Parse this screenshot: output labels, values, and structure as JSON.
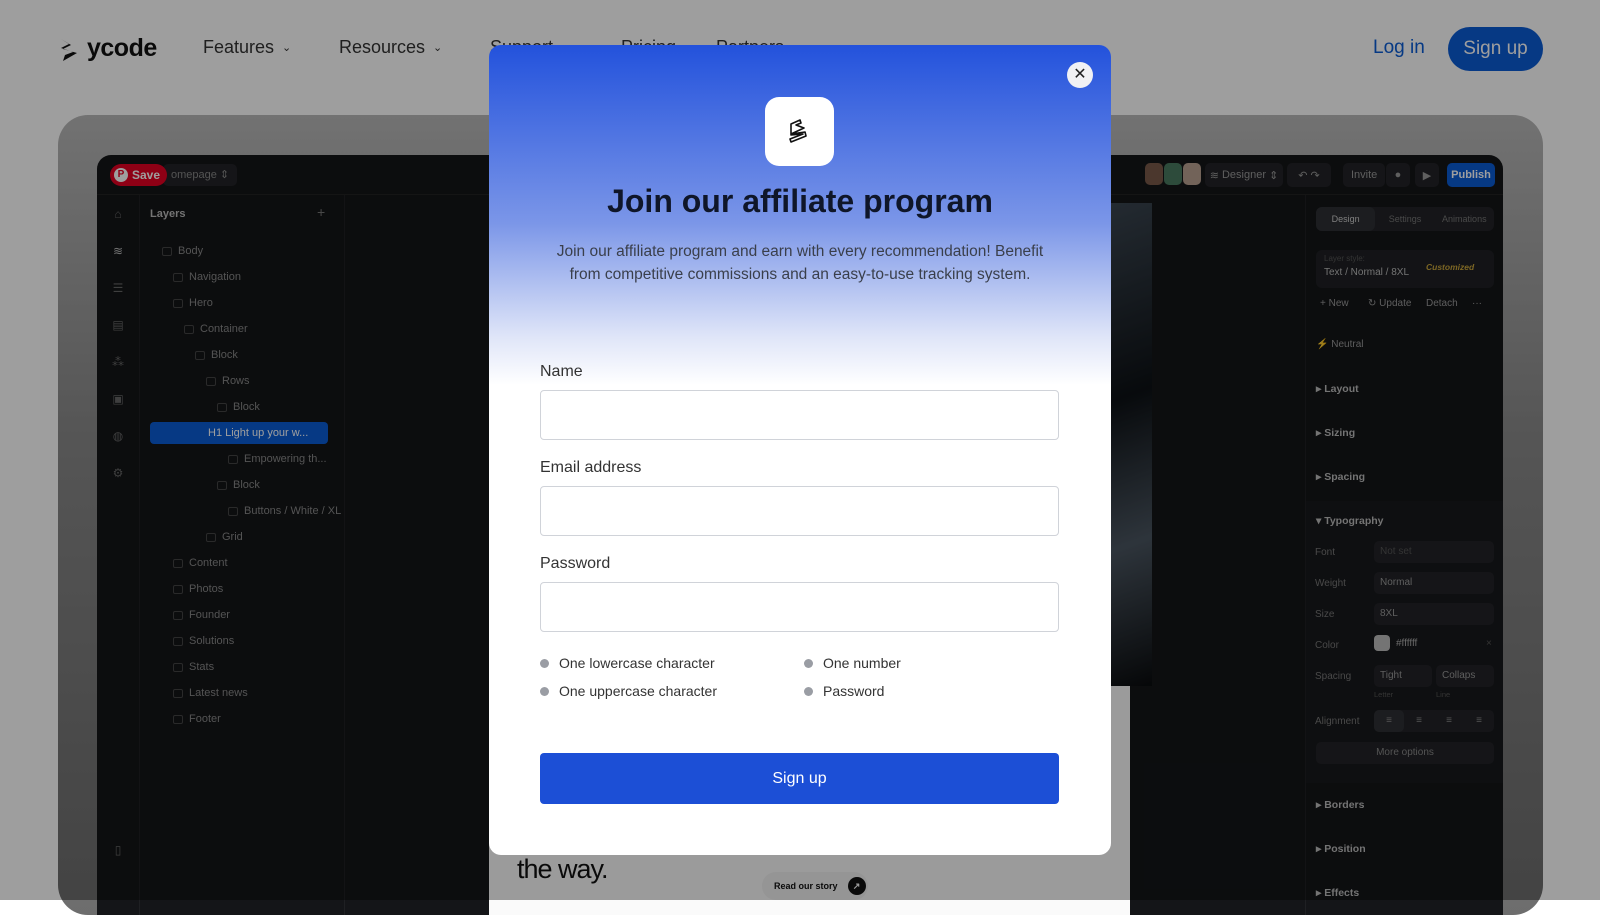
{
  "nav": {
    "brand": "ycode",
    "items": [
      "Features",
      "Resources",
      "Support",
      "Pricing",
      "Partners"
    ],
    "login": "Log in",
    "signup": "Sign up",
    "accent": "#0b5cd6"
  },
  "app": {
    "save_pin": "Save",
    "page_selector": "omepage",
    "mode": "Designer",
    "invite": "Invite",
    "publish": "Publish",
    "layers_title": "Layers",
    "layers": [
      {
        "label": "Body",
        "depth": 0
      },
      {
        "label": "Navigation",
        "depth": 1
      },
      {
        "label": "Hero",
        "depth": 1
      },
      {
        "label": "Container",
        "depth": 2
      },
      {
        "label": "Block",
        "depth": 3
      },
      {
        "label": "Rows",
        "depth": 4
      },
      {
        "label": "Block",
        "depth": 5
      },
      {
        "label": "H1  Light up your w...",
        "depth": 6,
        "selected": true
      },
      {
        "label": "Empowering th...",
        "depth": 6
      },
      {
        "label": "Block",
        "depth": 5
      },
      {
        "label": "Buttons / White / XL",
        "depth": 6
      },
      {
        "label": "Grid",
        "depth": 4
      },
      {
        "label": "Content",
        "depth": 1
      },
      {
        "label": "Photos",
        "depth": 1
      },
      {
        "label": "Founder",
        "depth": 1
      },
      {
        "label": "Solutions",
        "depth": 1
      },
      {
        "label": "Stats",
        "depth": 1
      },
      {
        "label": "Latest news",
        "depth": 1
      },
      {
        "label": "Footer",
        "depth": 1
      }
    ],
    "canvas": {
      "heading_fragment": "the way.",
      "story_button": "Read our story"
    },
    "panel": {
      "tabs": [
        "Design",
        "Settings",
        "Animations"
      ],
      "layer_style_label": "Layer style:",
      "layer_style": "Text / Normal / 8XL",
      "customized": "Customized",
      "actions": [
        "+ New",
        "Update",
        "Detach",
        "···"
      ],
      "neutral": "Neutral",
      "sections": [
        "Layout",
        "Sizing",
        "Spacing",
        "Typography",
        "Borders",
        "Position",
        "Effects"
      ],
      "font_label": "Font",
      "font": "Not set",
      "weight_label": "Weight",
      "weight": "Normal",
      "size_label": "Size",
      "size": "8XL",
      "color_label": "Color",
      "color": "#ffffff",
      "spacing_label": "Spacing",
      "letter": "Tight",
      "line": "Collaps",
      "letter_caption": "Letter",
      "line_caption": "Line",
      "alignment_label": "Alignment",
      "more_options": "More options"
    }
  },
  "modal": {
    "title": "Join our affiliate program",
    "subtitle": "Join our affiliate program and earn with every recommendation! Benefit from competitive commissions and an easy-to-use tracking system.",
    "fields": [
      {
        "label": "Name",
        "value": ""
      },
      {
        "label": "Email address",
        "value": ""
      },
      {
        "label": "Password",
        "value": ""
      }
    ],
    "rules": [
      "One lowercase character",
      "One number",
      "One uppercase character",
      "Password"
    ],
    "submit": "Sign up",
    "button_color": "#1c4fd6"
  }
}
